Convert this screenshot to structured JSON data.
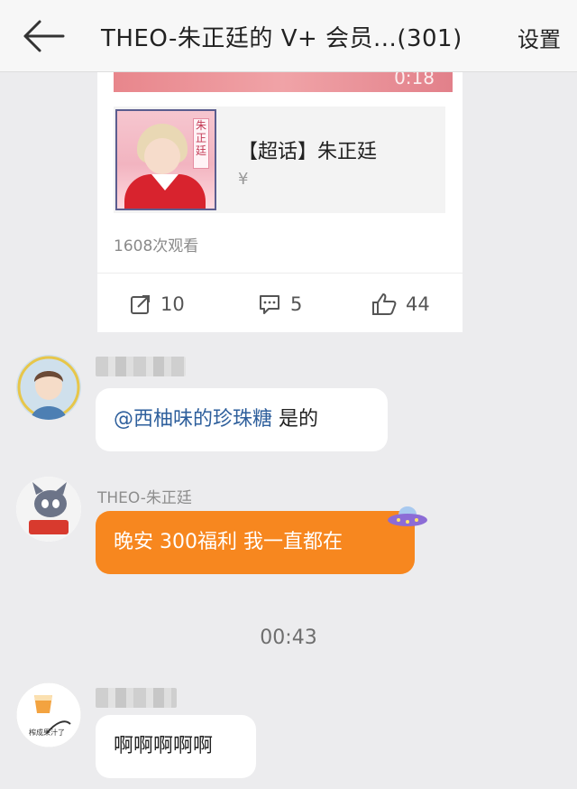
{
  "header": {
    "title": "THEO-朱正廷的 V+ 会员...(301)",
    "settings_label": "设置"
  },
  "shared_post": {
    "video_duration": "0:18",
    "topic_title": "【超话】朱正廷",
    "topic_sub": "¥",
    "thumb_tag": "朱正廷",
    "views": "1608次观看",
    "reposts": "10",
    "comments": "5",
    "likes": "44"
  },
  "messages": [
    {
      "sender": "",
      "mention": "@西柚味的珍珠糖",
      "text": "是的"
    },
    {
      "sender": "THEO-朱正廷",
      "text": "晚安 300福利 我一直都在"
    },
    {
      "time": "00:43"
    },
    {
      "sender": "",
      "text": "啊啊啊啊啊"
    }
  ],
  "colors": {
    "page_bg": "#ececee",
    "orange_bubble": "#f7871f",
    "mention": "#2e5f9c"
  },
  "icons": [
    "back-arrow-icon",
    "repost-icon",
    "comment-icon",
    "like-icon",
    "ufo-sticker-icon"
  ]
}
